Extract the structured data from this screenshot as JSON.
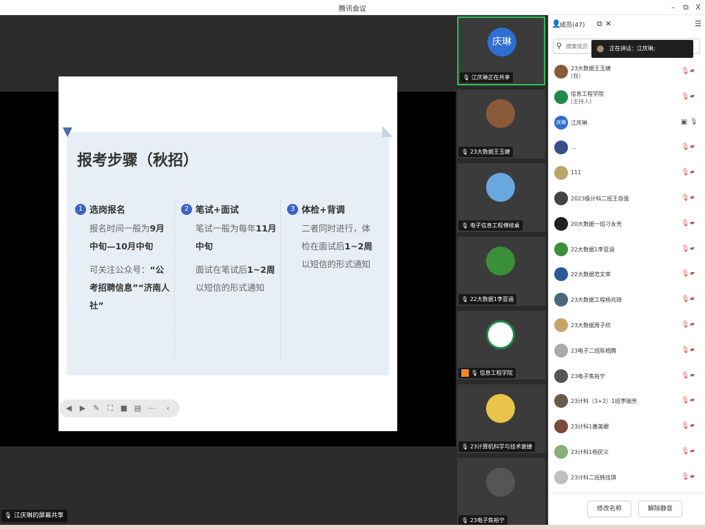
{
  "app": {
    "title": "腾讯会议",
    "minimize": "–",
    "restore": "⧉",
    "close": "X"
  },
  "slide": {
    "heading": "报考步骤（秋招）",
    "columns": [
      {
        "num": "1",
        "title": "选岗报名",
        "p1_pre": "报名时间一般为",
        "p1_bold": "9月中旬—10月中旬",
        "p2_pre": "可关注公众号：",
        "p2_bold": "“公考招聘信息”“济南人社”"
      },
      {
        "num": "2",
        "title": "笔试+面试",
        "p1_pre": "笔试一般为每年",
        "p1_bold": "11月中旬",
        "p2_pre": "面试在笔试后",
        "p2_bold": "1~2周",
        "p2_post": "以短信的形式通知"
      },
      {
        "num": "3",
        "title": "体检+背调",
        "p1_pre": "二者同时进行，体检在面试后",
        "p1_bold": "1~2周",
        "p1_post": "以短信的形式通知"
      }
    ]
  },
  "share_label": "江庆琳的屏幕共享",
  "video_tiles": [
    {
      "label": "江庆琳正在共享",
      "avatar_text": "庆琳",
      "color": "#2f6fd1",
      "active": true
    },
    {
      "label": "23大数据王玉婕",
      "avatar_text": "",
      "color": "#8a5a3c"
    },
    {
      "label": "电子信息工程傅续桌",
      "avatar_text": "",
      "color": "#6aa7e0"
    },
    {
      "label": "22大数据1李亚涵",
      "avatar_text": "",
      "color": "#3a8f3a"
    },
    {
      "label": "信息工程学院",
      "avatar_text": "",
      "color": "#1f8a4c",
      "host": true
    },
    {
      "label": "23计算机科学与技术谢捷",
      "avatar_text": "",
      "color": "#e8c44a"
    },
    {
      "label": "23电子焦裕宁",
      "avatar_text": "",
      "color": "#555555"
    }
  ],
  "members": {
    "header": "成员(47)",
    "search_placeholder": "搜索成员",
    "speaking": "正在讲话：江庆琳;",
    "rows": [
      {
        "name": "23大数据王玉婕",
        "role": "(我)",
        "color": "#8a5a3c"
      },
      {
        "name": "信息工程学院",
        "role": "(主持人)",
        "color": "#1f8a4c"
      },
      {
        "name": "江庆琳",
        "role": "",
        "color": "#2f6fd1",
        "avatar_text": "庆琳",
        "ok": true
      },
      {
        "name": "...",
        "role": "",
        "color": "#3a4f8a"
      },
      {
        "name": "111",
        "role": "",
        "color": "#b9a56a"
      },
      {
        "name": "2023级计科二班王自强",
        "role": "",
        "color": "#444444"
      },
      {
        "name": "20大数据一班刁永芳",
        "role": "",
        "color": "#222222"
      },
      {
        "name": "22大数据1李亚涵",
        "role": "",
        "color": "#3a8f3a"
      },
      {
        "name": "22大数据范文荣",
        "role": "",
        "color": "#2a5a9a"
      },
      {
        "name": "23大数据工程杨兆琦",
        "role": "",
        "color": "#4a6a7a"
      },
      {
        "name": "23大数据周子欣",
        "role": "",
        "color": "#c9a46a"
      },
      {
        "name": "23电子二班陈相腾",
        "role": "",
        "color": "#aaaaaa"
      },
      {
        "name": "23电子焦裕宁",
        "role": "",
        "color": "#555555"
      },
      {
        "name": "23计科（3+2）1班李瑞芳",
        "role": "",
        "color": "#6a5a4a"
      },
      {
        "name": "23计科1唐美娜",
        "role": "",
        "color": "#7a4a3a"
      },
      {
        "name": "23计科1杨民义",
        "role": "",
        "color": "#8ab07a"
      },
      {
        "name": "23计科二班韩佳琪",
        "role": "",
        "color": "#c0c0c0"
      }
    ],
    "rename_button": "修改名称",
    "unmute_button": "解除静音"
  }
}
